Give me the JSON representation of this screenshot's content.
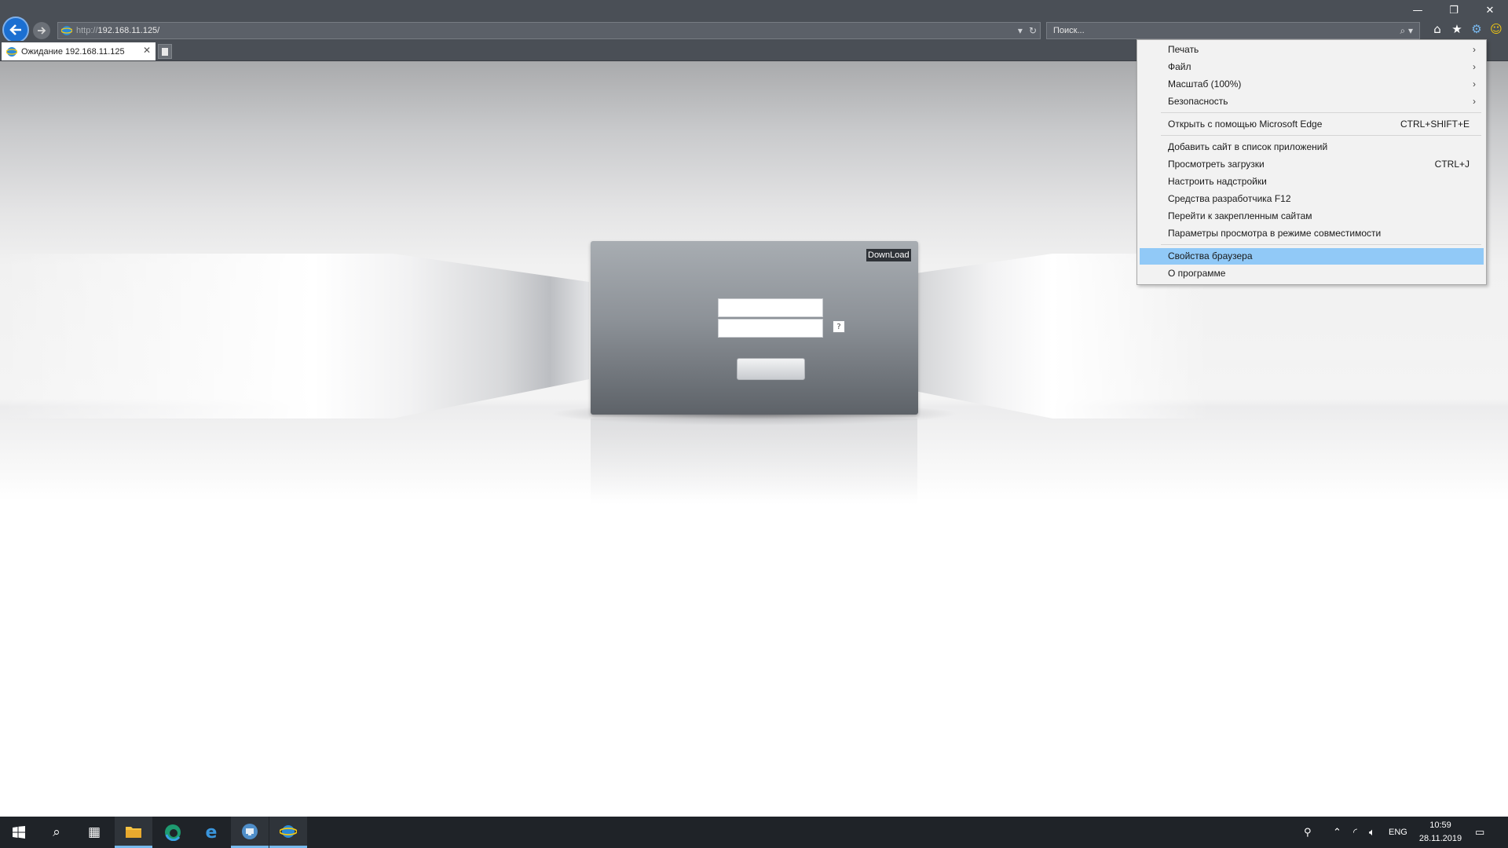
{
  "address_bar": {
    "url_protocol": "http://",
    "url_host": "192.168.11.125/"
  },
  "search": {
    "placeholder": "Поиск..."
  },
  "tab": {
    "title": "Ожидание 192.168.11.125"
  },
  "login_panel": {
    "download_label": "DownLoad",
    "help_label": "?"
  },
  "menu": {
    "items": [
      {
        "label": "Печать",
        "submenu": true
      },
      {
        "label": "Файл",
        "submenu": true
      },
      {
        "label": "Масштаб (100%)",
        "submenu": true
      },
      {
        "label": "Безопасность",
        "submenu": true
      },
      {
        "label": "Открыть с помощью Microsoft Edge",
        "shortcut": "CTRL+SHIFT+E"
      },
      {
        "label": "Добавить сайт в список приложений"
      },
      {
        "label": "Просмотреть загрузки",
        "shortcut": "CTRL+J"
      },
      {
        "label": "Настроить надстройки"
      },
      {
        "label": "Средства разработчика F12"
      },
      {
        "label": "Перейти к закрепленным сайтам"
      },
      {
        "label": "Параметры просмотра в режиме совместимости"
      },
      {
        "label": "Свойства браузера",
        "highlighted": true
      },
      {
        "label": "О программе"
      }
    ]
  },
  "taskbar": {
    "language": "ENG",
    "time": "10:59",
    "date": "28.11.2019"
  },
  "colors": {
    "chrome_bg": "#4a4f56",
    "menu_highlight": "#91c9f7",
    "taskbar_bg": "#1f2328"
  }
}
